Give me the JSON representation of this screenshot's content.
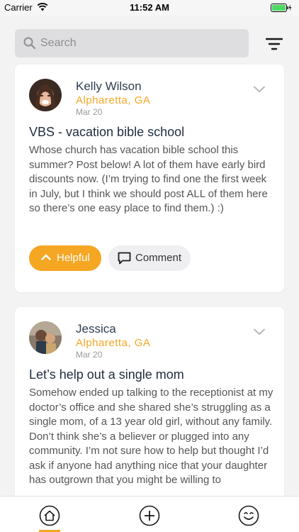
{
  "status_bar": {
    "carrier": "Carrier",
    "time": "11:52 AM",
    "wifi_icon": "wifi-icon",
    "battery_icon": "battery-icon"
  },
  "search": {
    "placeholder": "Search",
    "icon": "search-icon"
  },
  "filter": {
    "icon": "filter-icon"
  },
  "colors": {
    "accent": "#f5a623",
    "title": "#1f2d3d",
    "background": "#f3f3f4"
  },
  "posts": [
    {
      "author": "Kelly Wilson",
      "location": "Alpharetta, GA",
      "date": "Mar 20",
      "title": "VBS - vacation bible school",
      "body": "Whose church has vacation bible school this summer? Post below! A lot of them have early bird discounts now. (I’m trying to find one the first week in July, but I think we should post ALL of them here so there’s one easy place to find them.) :)",
      "helpful_label": "Helpful",
      "comment_label": "Comment"
    },
    {
      "author": "Jessica",
      "location": "Alpharetta, GA",
      "date": "Mar 20",
      "title": "Let’s help out a single mom",
      "body": "Somehow ended up talking to the receptionist at my doctor’s office and she shared she’s struggling as a single mom, of a 13 year old girl, without any family. Don’t think she’s a believer or plugged into any community. I’m not sure how to help but thought I’d ask if anyone had anything nice that your daughter has outgrown that you might be willing to"
    }
  ],
  "tab_bar": {
    "tabs": [
      {
        "icon": "home-icon",
        "active": true
      },
      {
        "icon": "add-icon",
        "active": false
      },
      {
        "icon": "smiley-icon",
        "active": false
      }
    ]
  }
}
